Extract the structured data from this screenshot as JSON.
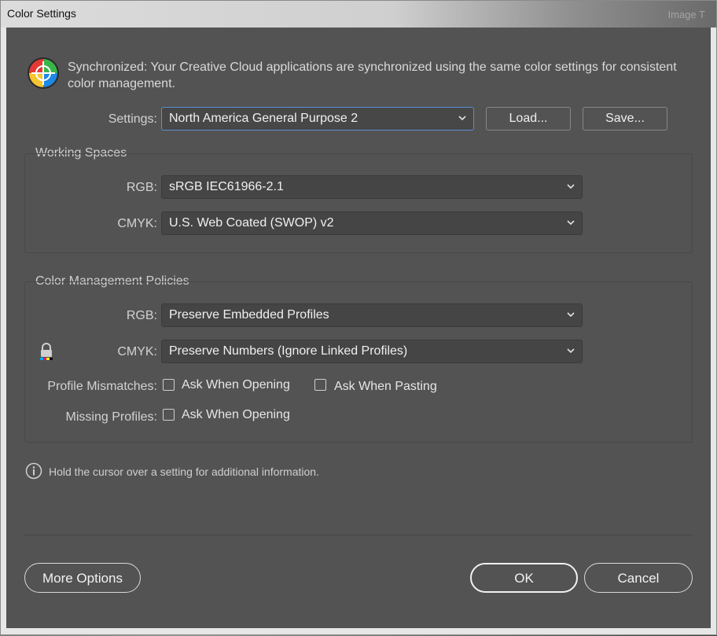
{
  "window": {
    "title": "Color Settings",
    "ghost_text": "Image T"
  },
  "sync": {
    "message": "Synchronized: Your Creative Cloud applications are synchronized using the same color settings for consistent color management."
  },
  "settings": {
    "label": "Settings:",
    "value": "North America General Purpose 2",
    "load_label": "Load...",
    "save_label": "Save..."
  },
  "working_spaces": {
    "title": "Working Spaces",
    "rgb_label": "RGB:",
    "rgb_value": "sRGB IEC61966-2.1",
    "cmyk_label": "CMYK:",
    "cmyk_value": "U.S. Web Coated (SWOP) v2"
  },
  "policies": {
    "title": "Color Management Policies",
    "rgb_label": "RGB:",
    "rgb_value": "Preserve Embedded Profiles",
    "cmyk_label": "CMYK:",
    "cmyk_value": "Preserve Numbers (Ignore Linked Profiles)",
    "mismatch_label": "Profile Mismatches:",
    "mismatch_opening": "Ask When Opening",
    "mismatch_pasting": "Ask When Pasting",
    "missing_label": "Missing Profiles:",
    "missing_opening": "Ask When Opening",
    "mismatch_opening_checked": false,
    "mismatch_pasting_checked": false,
    "missing_opening_checked": false
  },
  "info": {
    "text": "Hold the cursor over a setting for additional information."
  },
  "footer": {
    "more_options": "More Options",
    "ok": "OK",
    "cancel": "Cancel"
  },
  "icons": {
    "sync": "color-wheel-icon",
    "lock": "lock-icon",
    "info": "info-icon",
    "dropdown": "chevron-down-icon"
  },
  "colors": {
    "panel_bg": "#535353",
    "focus_border": "#5b8fd1"
  }
}
